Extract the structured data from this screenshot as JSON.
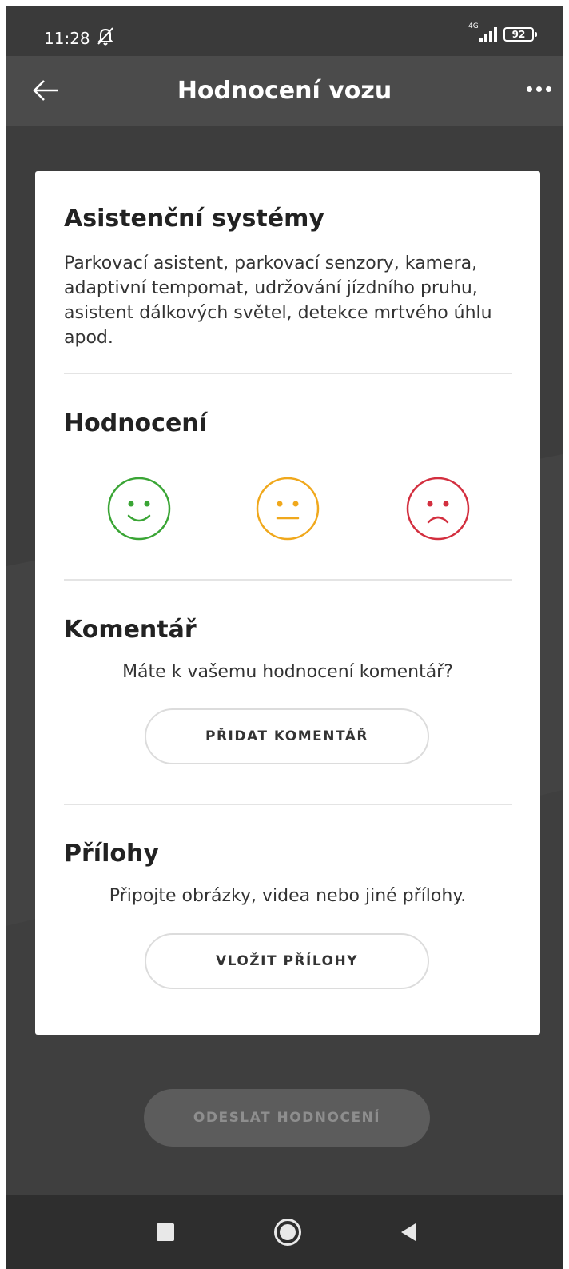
{
  "status_bar": {
    "time": "11:28",
    "network": "4G",
    "battery": "92",
    "icons": [
      "bell-off-icon",
      "signal-icon",
      "battery-icon"
    ]
  },
  "app_bar": {
    "title": "Hodnocení vozu",
    "icons": [
      "arrow-left-icon",
      "more-dots-icon"
    ]
  },
  "card": {
    "category_title": "Asistenční systémy",
    "category_description": "Parkovací asistent, parkovací senzory, kamera, adaptivní tempomat, udržování jízdního pruhu, asistent dálkových světel, detekce mrtvého úhlu apod.",
    "rating": {
      "title": "Hodnocení",
      "options": [
        {
          "icon": "smile-face-icon",
          "color": "#3aa535"
        },
        {
          "icon": "neutral-face-icon",
          "color": "#f0a81c"
        },
        {
          "icon": "sad-face-icon",
          "color": "#d32f3f"
        }
      ]
    },
    "comment": {
      "title": "Komentář",
      "prompt": "Máte k vašemu hodnocení komentář?",
      "button_label": "PŘIDAT KOMENTÁŘ"
    },
    "attachments": {
      "title": "Přílohy",
      "prompt": "Připojte obrázky, videa nebo jiné přílohy.",
      "button_label": "VLOŽIT PŘÍLOHY"
    }
  },
  "submit_label": "ODESLAT HODNOCENÍ",
  "nav_bar": {
    "icons": [
      "recents-square-icon",
      "home-circle-icon",
      "back-triangle-icon"
    ]
  },
  "colors": {
    "background": "#3d3d3d",
    "app_bar": "#4b4b4b",
    "card": "#ffffff",
    "positive": "#3aa535",
    "neutral": "#f0a81c",
    "negative": "#d32f3f",
    "submit_disabled": "#5c5c5c"
  }
}
